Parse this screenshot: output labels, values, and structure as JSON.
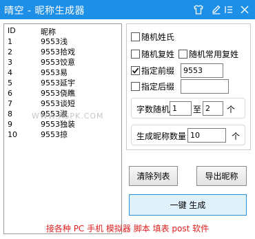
{
  "window": {
    "title": "晴空 - 昵称生成器",
    "controls": [
      "shirt-icon",
      "pen-icon",
      "list-icon",
      "close-icon"
    ]
  },
  "list": {
    "headers": [
      "ID",
      "昵称"
    ],
    "rows": [
      {
        "id": "1",
        "name": "9553浅"
      },
      {
        "id": "2",
        "name": "9553拾戏"
      },
      {
        "id": "3",
        "name": "9553饺意"
      },
      {
        "id": "4",
        "name": "9553易"
      },
      {
        "id": "5",
        "name": "9553延宇"
      },
      {
        "id": "6",
        "name": "9553侥瞧"
      },
      {
        "id": "7",
        "name": "9553谈短"
      },
      {
        "id": "8",
        "name": "9553淑"
      },
      {
        "id": "9",
        "name": "9553独装"
      },
      {
        "id": "10",
        "name": "9553掠"
      }
    ]
  },
  "watermark": "WWW.ASPK.COM",
  "options": {
    "random_surname": {
      "label": "随机姓氏",
      "checked": false
    },
    "random_compound_surname": {
      "label": "随机复姓",
      "checked": false
    },
    "random_common_compound": {
      "label": "随机常用复姓",
      "checked": false
    },
    "prefix": {
      "label": "指定前缀",
      "checked": true,
      "value": "9553"
    },
    "suffix": {
      "label": "指定后缀",
      "checked": false,
      "value": ""
    }
  },
  "word_count": {
    "label": "字数随机",
    "min": "1",
    "to": "至",
    "max": "2",
    "unit": "个"
  },
  "quantity": {
    "label": "生成昵称数量",
    "value": "10",
    "unit": "个"
  },
  "buttons": {
    "clear": "清除列表",
    "export": "导出昵称",
    "generate": "一键 生成"
  },
  "footer": "接各种 PC 手机 模拟器 脚本 填表 post 软件",
  "colors": {
    "titlebar": "#1e8fe6",
    "footer_text": "#e01e1e",
    "primary_border": "#2a8ed8"
  }
}
